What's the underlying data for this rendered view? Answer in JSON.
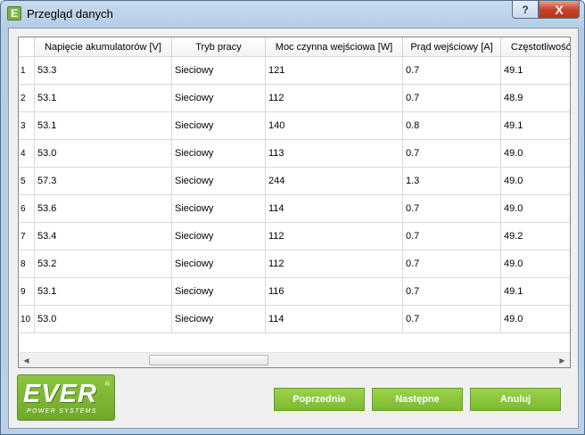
{
  "window": {
    "title": "Przegląd danych",
    "app_icon_letter": "E",
    "help_label": "?",
    "close_label": "X"
  },
  "table": {
    "columns": [
      "Napięcie akumulatorów [V]",
      "Tryb pracy",
      "Moc czynna wejściowa [W]",
      "Prąd wejściowy [A]",
      "Częstotliwość"
    ],
    "rows": [
      {
        "n": "1",
        "voltage": "53.3",
        "mode": "Sieciowy",
        "power": "121",
        "current": "0.7",
        "freq": "49.1"
      },
      {
        "n": "2",
        "voltage": "53.1",
        "mode": "Sieciowy",
        "power": "112",
        "current": "0.7",
        "freq": "48.9"
      },
      {
        "n": "3",
        "voltage": "53.1",
        "mode": "Sieciowy",
        "power": "140",
        "current": "0.8",
        "freq": "49.1"
      },
      {
        "n": "4",
        "voltage": "53.0",
        "mode": "Sieciowy",
        "power": "113",
        "current": "0.7",
        "freq": "49.0"
      },
      {
        "n": "5",
        "voltage": "57.3",
        "mode": "Sieciowy",
        "power": "244",
        "current": "1.3",
        "freq": "49.0"
      },
      {
        "n": "6",
        "voltage": "53.6",
        "mode": "Sieciowy",
        "power": "114",
        "current": "0.7",
        "freq": "49.0"
      },
      {
        "n": "7",
        "voltage": "53.4",
        "mode": "Sieciowy",
        "power": "112",
        "current": "0.7",
        "freq": "49.2"
      },
      {
        "n": "8",
        "voltage": "53.2",
        "mode": "Sieciowy",
        "power": "112",
        "current": "0.7",
        "freq": "49.0"
      },
      {
        "n": "9",
        "voltage": "53.1",
        "mode": "Sieciowy",
        "power": "116",
        "current": "0.7",
        "freq": "49.1"
      },
      {
        "n": "10",
        "voltage": "53.0",
        "mode": "Sieciowy",
        "power": "114",
        "current": "0.7",
        "freq": "49.0"
      }
    ]
  },
  "logo": {
    "word": "EVER",
    "registered": "®",
    "tagline": "POWER SYSTEMS"
  },
  "buttons": {
    "prev": "Poprzednie",
    "next": "Następne",
    "cancel": "Anuluj"
  },
  "colors": {
    "accent_green": "#8cc63f",
    "close_red": "#c7452a"
  },
  "icons": {
    "scroll_left": "triangle-left-icon",
    "scroll_right": "triangle-right-icon"
  }
}
